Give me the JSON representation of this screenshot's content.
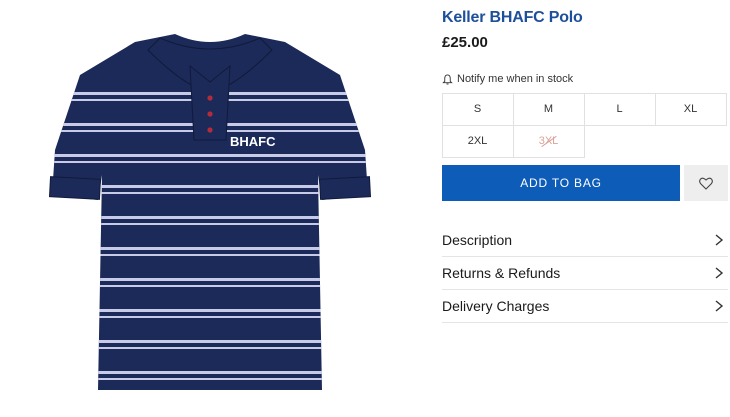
{
  "product": {
    "title": "Keller BHAFC Polo",
    "price": "£25.00",
    "shirt_logo": "BHAFC",
    "shirt_colors": {
      "navy": "#1c2a59",
      "stripe": "#c8cbe8"
    }
  },
  "notify": {
    "label": "Notify me when in stock",
    "icon": "bell-icon"
  },
  "sizes": [
    {
      "label": "S",
      "available": true
    },
    {
      "label": "M",
      "available": true
    },
    {
      "label": "L",
      "available": true
    },
    {
      "label": "XL",
      "available": true
    },
    {
      "label": "2XL",
      "available": true
    },
    {
      "label": "3XL",
      "available": false
    }
  ],
  "actions": {
    "add_to_bag": "ADD TO BAG",
    "wishlist_icon": "heart-icon",
    "accent_color": "#0d5cb8"
  },
  "accordion": [
    {
      "label": "Description",
      "icon": "chevron-right-icon"
    },
    {
      "label": "Returns & Refunds",
      "icon": "chevron-right-icon"
    },
    {
      "label": "Delivery Charges",
      "icon": "chevron-right-icon"
    }
  ]
}
